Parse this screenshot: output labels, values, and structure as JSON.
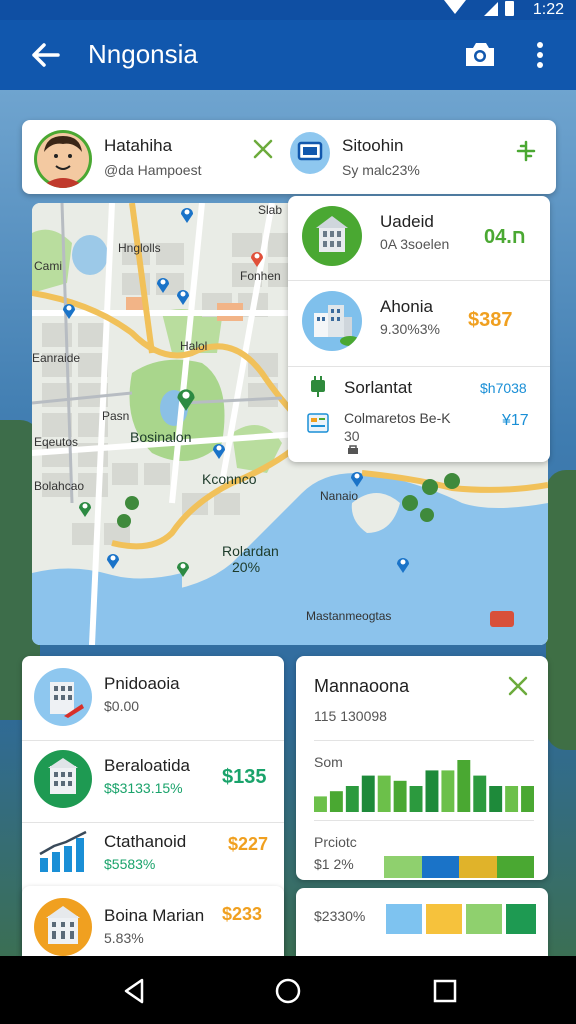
{
  "status": {
    "time": "1:22"
  },
  "appbar": {
    "title": "Nngonsia"
  },
  "top_card": {
    "user_name": "Hatahiha",
    "user_sub": "@da Hampoest",
    "right_title": "Sitoohin",
    "right_sub": "Sy malc23%"
  },
  "side_list": [
    {
      "title": "Uadeid",
      "sub": "0A 3soelen",
      "value": "ח.04",
      "value_color": "#4aa832"
    },
    {
      "title": "Ahonia",
      "sub": "9.30%3%",
      "value": "$387",
      "value_color": "#f0a020"
    },
    {
      "title": "Sorlantat",
      "sub": "",
      "value": "$h7038",
      "value_color": "#1a8fd6"
    },
    {
      "title": "Colmaretos Be-K",
      "sub": "30",
      "value": "¥17",
      "value_color": "#1a8fd6"
    }
  ],
  "map": {
    "labels": [
      "Slab",
      "Cami",
      "Hnglolls",
      "Fonhen",
      "Halol",
      "Eanraide",
      "Eqeutos",
      "Bosinalon",
      "Bolahcao",
      "Kconnco",
      "Nanaio",
      "Rolardan",
      "20%",
      "Mastanmeogtas",
      "Pasn"
    ]
  },
  "list_left": [
    {
      "title": "Pnidoaoia",
      "sub": "$0.00",
      "value": "",
      "value_color": "#4aa832"
    },
    {
      "title": "Beraloatida",
      "sub": "$$3133.15%",
      "value": "$135",
      "value_color": "#1aa36b"
    },
    {
      "title": "Ctathanoid",
      "sub": "$5583%",
      "value": "$227",
      "value_color": "#f0a020"
    },
    {
      "title": "Boina Marian",
      "sub": "5.83%",
      "value": "$233",
      "value_color": "#f0a020"
    }
  ],
  "panel_right": {
    "title": "Mannaoona",
    "sub": "115 130098",
    "chart_label": "Som",
    "price_label": "Prciotc",
    "price_value": "$1 2%",
    "bottom_value": "$2330%"
  },
  "colors": {
    "accent": "#1157ad",
    "green": "#4aa832",
    "orange": "#f0a020",
    "blue": "#1a8fd6"
  },
  "chart_data": {
    "type": "bar",
    "values": [
      3,
      4,
      5,
      7,
      7,
      6,
      5,
      8,
      8,
      10,
      7,
      5,
      5,
      5
    ],
    "ylim": [
      0,
      10
    ]
  }
}
